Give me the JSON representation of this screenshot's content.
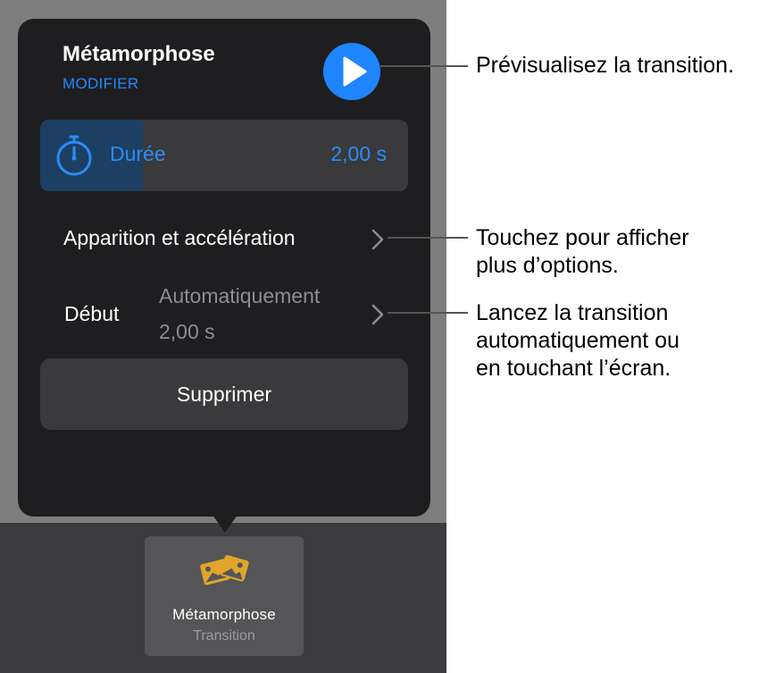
{
  "popover": {
    "title": "Métamorphose",
    "modify_label": "MODIFIER",
    "duration": {
      "label": "Durée",
      "value": "2,00 s",
      "slider_fill_fraction": 0.28
    },
    "ease_label": "Apparition et accélération",
    "start": {
      "label": "Début",
      "value_line1": "Automatiquement",
      "value_line2": "2,00 s"
    },
    "delete_label": "Supprimer"
  },
  "tray": {
    "tile_title": "Métamorphose",
    "tile_subtitle": "Transition",
    "tile_icon": "transition-photos-icon"
  },
  "callouts": {
    "preview": "Prévisualisez la transition.",
    "options_line1": "Touchez pour afficher",
    "options_line2": "plus d’options.",
    "start_line1": "Lancez la transition",
    "start_line2": "automatiquement ou",
    "start_line3": "en touchant l’écran."
  },
  "colors": {
    "accent": "#1f84ff",
    "popover_bg": "#1e1e20",
    "row_bg": "#3a3a3c",
    "icon_gold": "#e0a52a"
  }
}
